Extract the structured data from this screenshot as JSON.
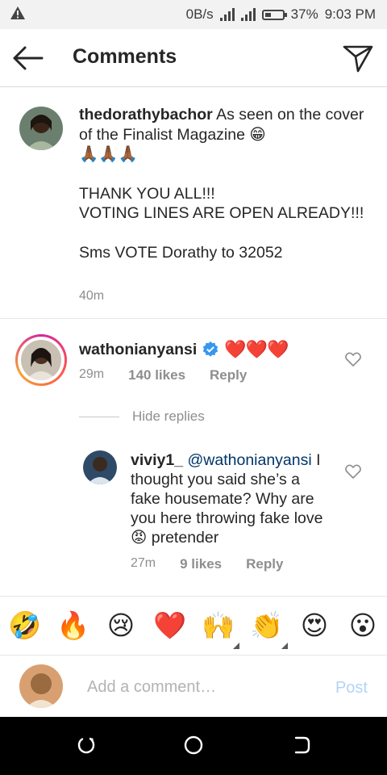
{
  "status_bar": {
    "speed": "0B/s",
    "battery": "37%",
    "time": "9:03 PM",
    "battery_level": 0.37
  },
  "header": {
    "title": "Comments",
    "back_icon": "arrow-left-icon",
    "send_icon": "paper-plane-icon"
  },
  "caption": {
    "username": "thedorathybachor",
    "text_line1": "As seen on the cover of the Finalist Magazine 😁",
    "emoji_line": "🙏🏾🙏🏾🙏🏾",
    "thanks": "THANK YOU ALL!!!",
    "voting": "VOTING LINES ARE OPEN ALREADY!!!",
    "sms": "Sms VOTE Dorathy to 32052",
    "time": "40m"
  },
  "comments": [
    {
      "username": "wathonianyansi",
      "verified": true,
      "text": "❤️❤️❤️",
      "time": "29m",
      "likes": "140 likes",
      "reply_label": "Reply"
    }
  ],
  "hide_replies": "Hide replies",
  "reply": {
    "username": "viviy1_",
    "mention": "@wathonianyansi",
    "text": "I thought you said she’s a fake housemate? Why are you here throwing fake love😡 pretender",
    "time": "27m",
    "likes": "9 likes",
    "reply_label": "Reply"
  },
  "emoji_bar": {
    "items": [
      "🤣",
      "🔥",
      "😢",
      "❤️",
      "🙌",
      "👏",
      "😍",
      "😮"
    ]
  },
  "composer": {
    "placeholder": "Add a comment…",
    "post_label": "Post"
  },
  "colors": {
    "link": "#003569",
    "meta": "#8e8e8e",
    "heart": "#e0142d",
    "post_disabled": "#b3d4f5",
    "verified": "#3897f0"
  }
}
